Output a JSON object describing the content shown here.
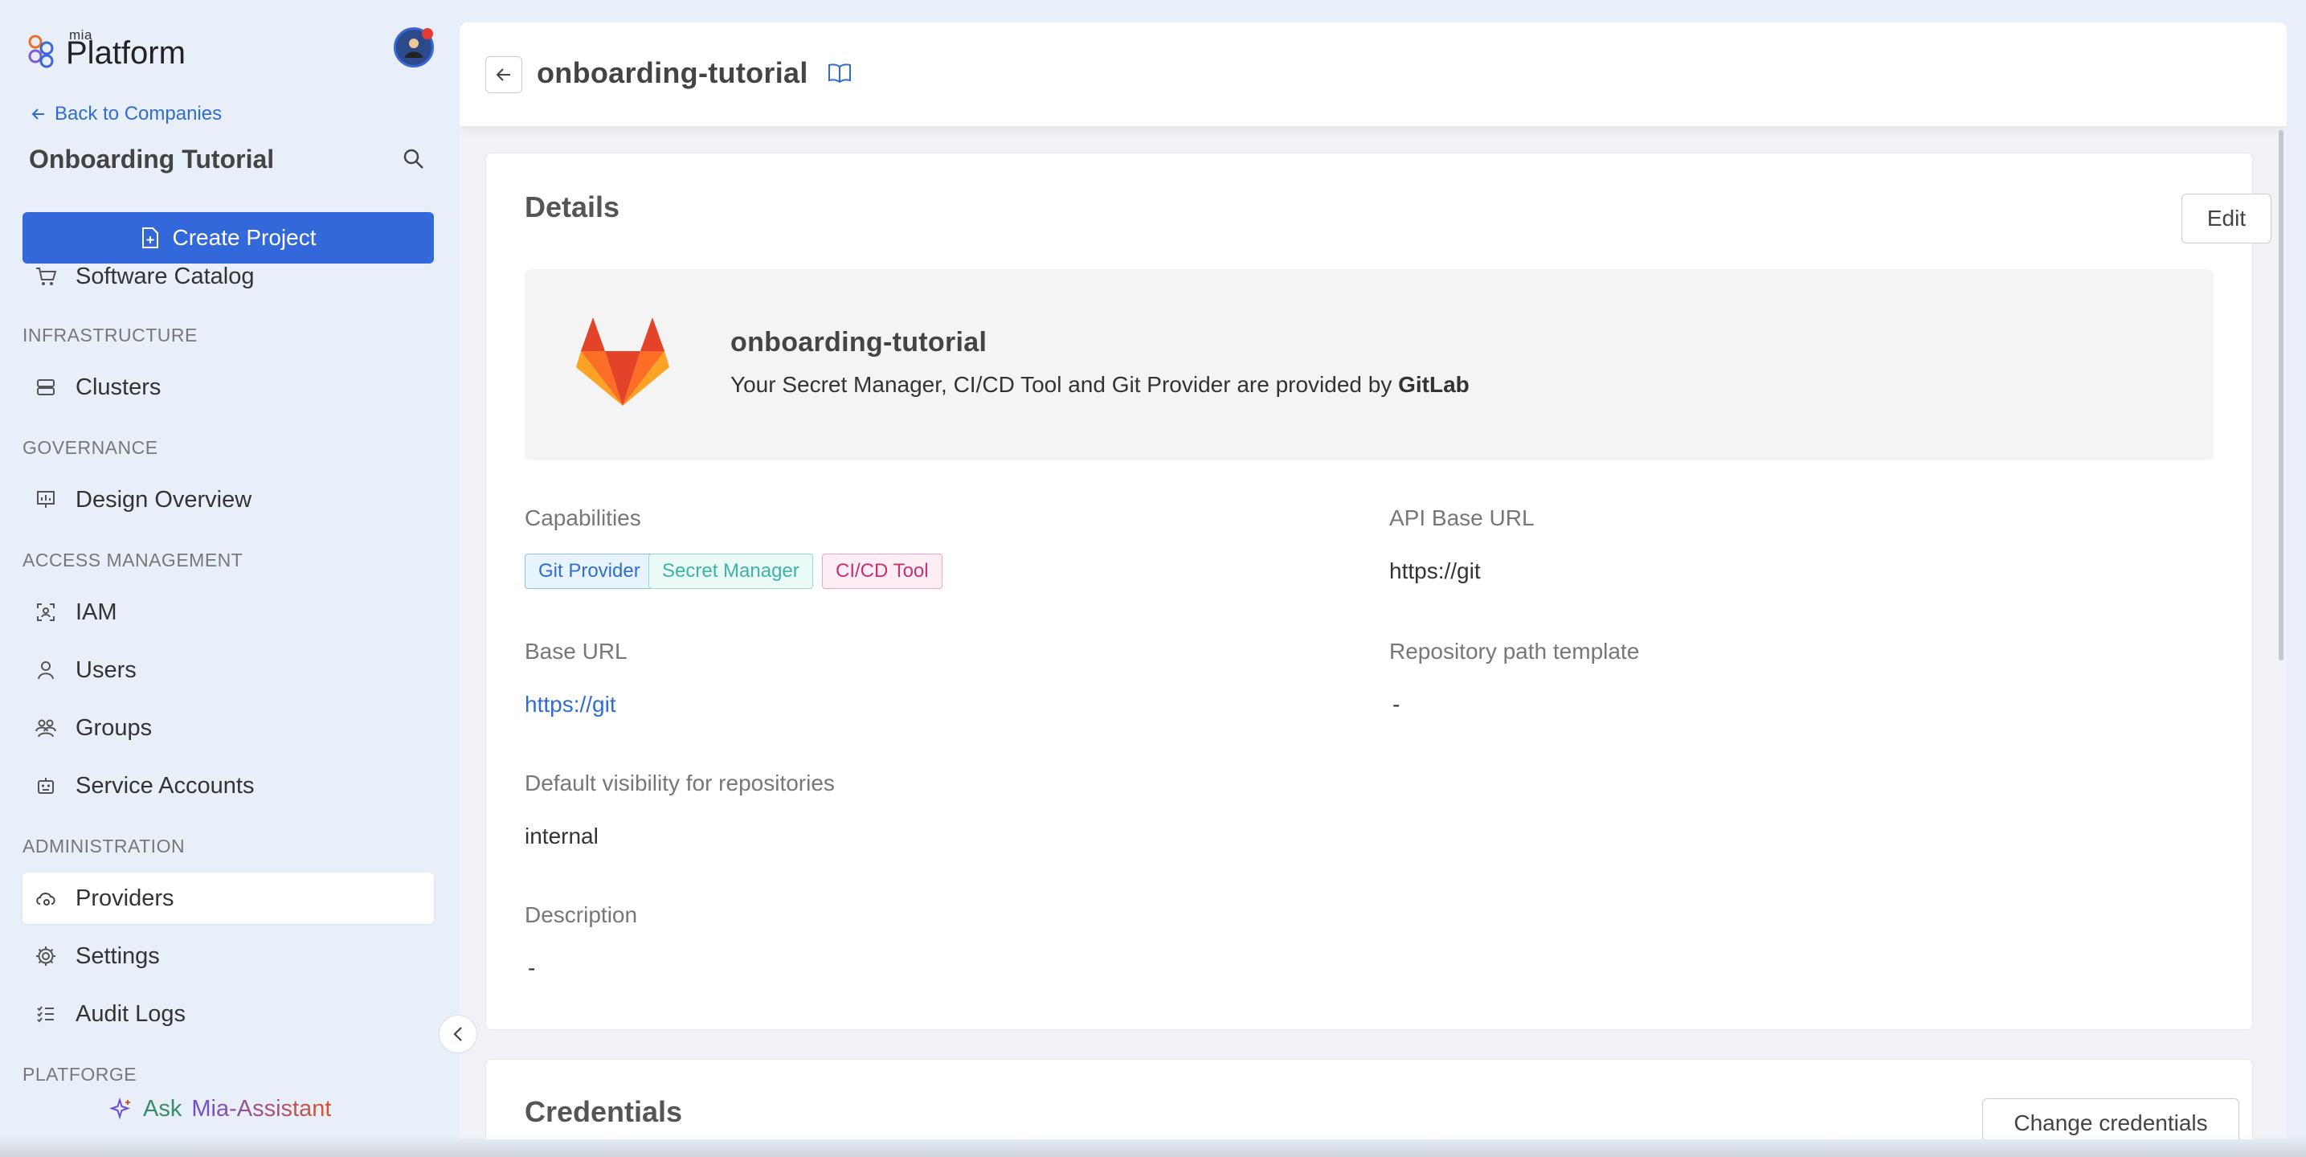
{
  "brand": {
    "small": "mia",
    "name": "Platform"
  },
  "sidebar": {
    "back_label": "Back to Companies",
    "company": "Onboarding Tutorial",
    "create_label": "Create Project",
    "catalog_label": "Software Catalog",
    "sections": {
      "infrastructure": "INFRASTRUCTURE",
      "governance": "GOVERNANCE",
      "access": "ACCESS MANAGEMENT",
      "administration": "ADMINISTRATION",
      "platforge": "PLATFORGE"
    },
    "items": {
      "clusters": "Clusters",
      "design": "Design Overview",
      "iam": "IAM",
      "users": "Users",
      "groups": "Groups",
      "service_accounts": "Service Accounts",
      "providers": "Providers",
      "settings": "Settings",
      "audit": "Audit Logs"
    },
    "ask": {
      "prefix": "Ask",
      "name": "Mia-Assistant"
    }
  },
  "header": {
    "title": "onboarding-tutorial"
  },
  "details": {
    "title": "Details",
    "edit_label": "Edit",
    "provider_name": "onboarding-tutorial",
    "provider_desc_prefix": "Your Secret Manager, CI/CD Tool and Git Provider are provided by ",
    "provider_desc_brand": "GitLab",
    "capabilities_label": "Capabilities",
    "tags": [
      "Git Provider",
      "Secret Manager",
      "CI/CD Tool"
    ],
    "api_base_url_label": "API Base URL",
    "api_base_url_value": "https://git",
    "base_url_label": "Base URL",
    "base_url_value": "https://git",
    "repo_path_label": "Repository path template",
    "repo_path_value": "-",
    "visibility_label": "Default visibility for repositories",
    "visibility_value": "internal",
    "description_label": "Description",
    "description_value": "-"
  },
  "credentials": {
    "title": "Credentials",
    "change_label": "Change credentials"
  },
  "colors": {
    "primary": "#3368db",
    "link": "#2f6dd1",
    "gitlab": "#e24329"
  }
}
